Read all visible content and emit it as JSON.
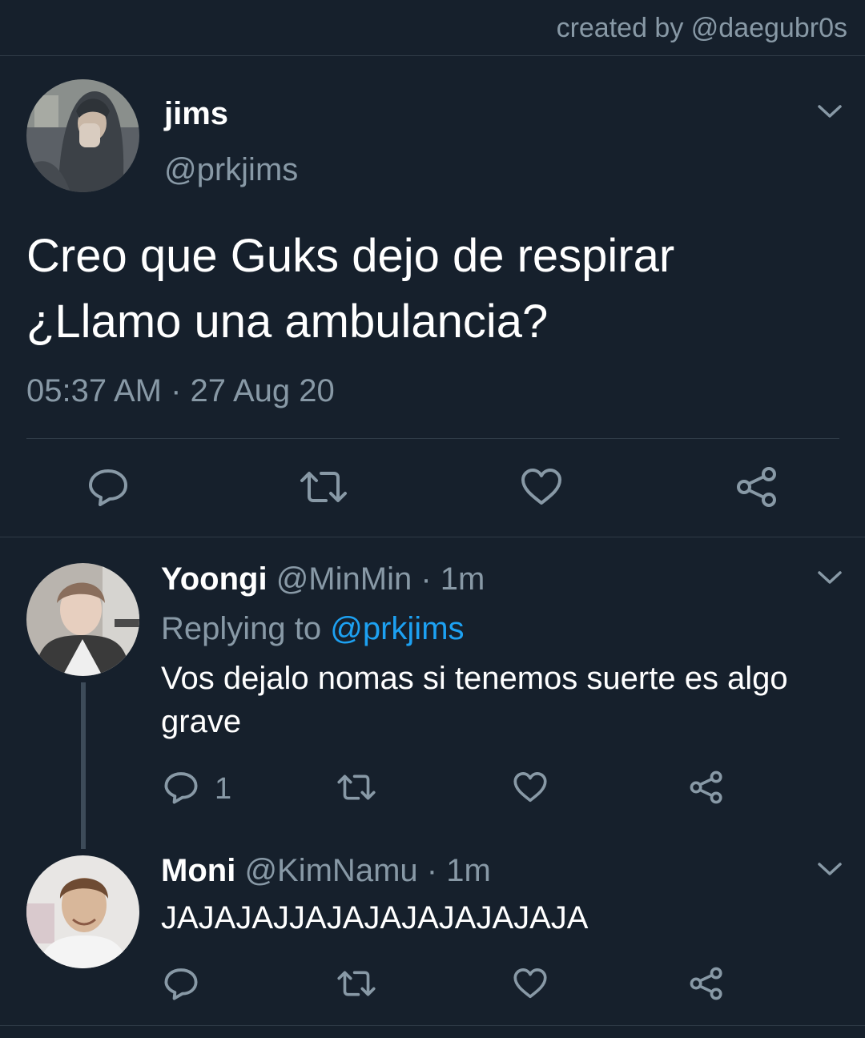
{
  "credit": "created by @daegubr0s",
  "main_tweet": {
    "display_name": "jims",
    "handle": "@prkjims",
    "text_line1": "Creo que Guks dejo de respirar",
    "text_line2": "¿Llamo una ambulancia?",
    "timestamp": "05:37 AM · 27 Aug 20"
  },
  "replies": [
    {
      "display_name": "Yoongi",
      "handle": "@MinMin",
      "time": "· 1m",
      "replying_prefix": "Replying to",
      "replying_handle": "@prkjims",
      "text_line1": "Vos dejalo nomas si tenemos suerte es algo",
      "text_line2": "grave",
      "reply_count": "1"
    },
    {
      "display_name": "Moni",
      "handle": "@KimNamu",
      "time": "· 1m",
      "text_line1": "JAJAJAJJAJAJAJAJAJAJAJA"
    }
  ],
  "colors": {
    "background": "#16202c",
    "muted_text": "#8899a6",
    "link": "#1da1f2",
    "divider": "#2f3b47"
  },
  "icons": [
    "chevron-down-icon",
    "reply-icon",
    "retweet-icon",
    "like-icon",
    "share-icon"
  ]
}
